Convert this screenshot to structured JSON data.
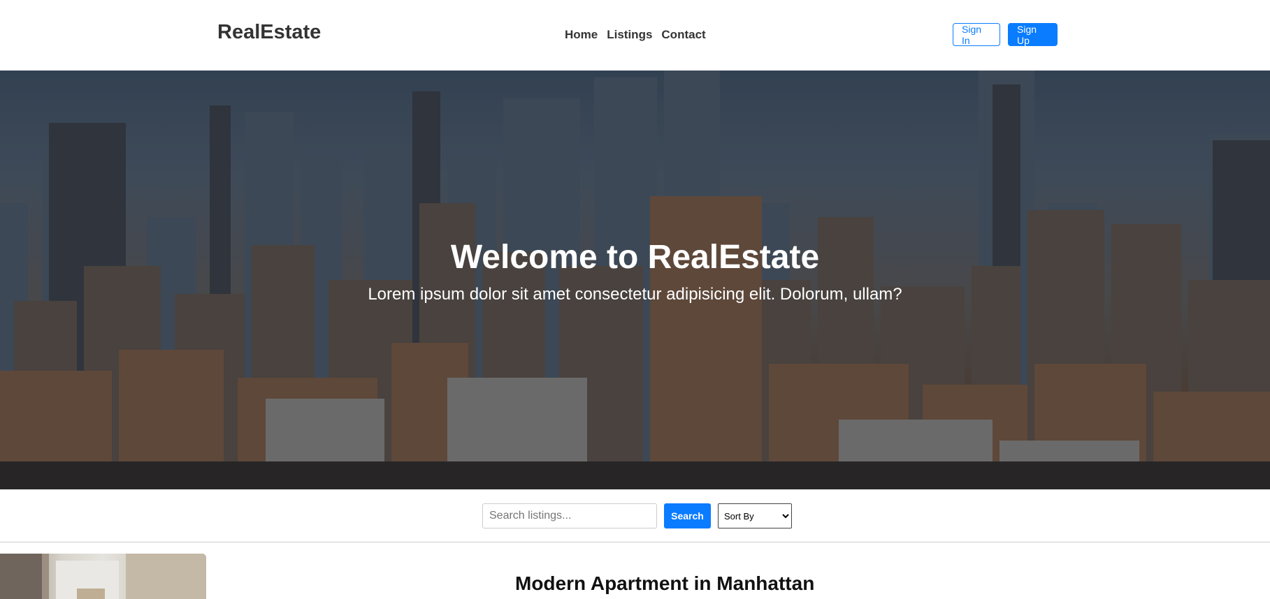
{
  "header": {
    "logo": "RealEstate",
    "nav": [
      "Home",
      "Listings",
      "Contact"
    ],
    "sign_in": "Sign In",
    "sign_up": "Sign Up"
  },
  "hero": {
    "title": "Welcome to RealEstate",
    "subtitle": "Lorem ipsum dolor sit amet consectetur adipisicing elit. Dolorum, ullam?"
  },
  "search": {
    "placeholder": "Search listings...",
    "button": "Search",
    "sort_selected": "Sort By"
  },
  "listing": {
    "title": "Modern Apartment in Manhattan"
  },
  "colors": {
    "accent": "#0a7cff"
  }
}
